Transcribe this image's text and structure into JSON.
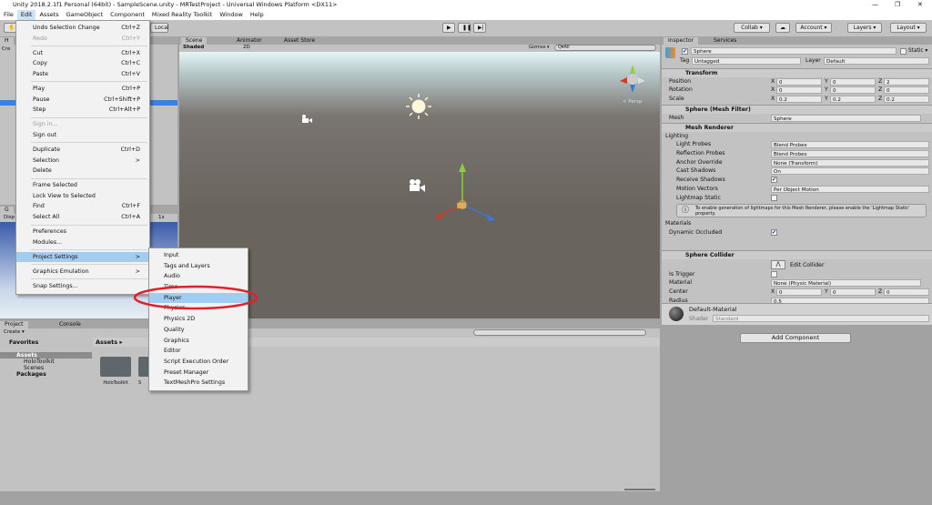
{
  "window": {
    "title": "Unity 2018.2.1f1 Personal (64bit) - SampleScene.unity - MRTestProject - Universal Windows Platform <DX11>"
  },
  "menubar": [
    "File",
    "Edit",
    "Assets",
    "GameObject",
    "Component",
    "Mixed Reality Toolkit",
    "Window",
    "Help"
  ],
  "toolbar": {
    "local": "Local",
    "collab": "Collab ▾",
    "account": "Account ▾",
    "layers": "Layers ▾",
    "layout": "Layout ▾"
  },
  "hierarchy": {
    "tab": "H",
    "create": "Cre"
  },
  "game": {
    "tab": "G",
    "display": "Disp",
    "scale": "1x"
  },
  "scene": {
    "tabs": [
      "Scene",
      "Animator",
      "Asset Store"
    ],
    "shading": "Shaded",
    "mode2d": "2D",
    "gizmos": "Gizmos ▾",
    "search_placeholder": "Q▾All",
    "persp": "< Persp"
  },
  "edit_menu": [
    {
      "label": "Undo Selection Change",
      "shortcut": "Ctrl+Z"
    },
    {
      "label": "Redo",
      "shortcut": "Ctrl+Y",
      "disabled": true
    },
    {
      "sep": true
    },
    {
      "label": "Cut",
      "shortcut": "Ctrl+X"
    },
    {
      "label": "Copy",
      "shortcut": "Ctrl+C"
    },
    {
      "label": "Paste",
      "shortcut": "Ctrl+V"
    },
    {
      "sep": true
    },
    {
      "label": "Play",
      "shortcut": "Ctrl+P"
    },
    {
      "label": "Pause",
      "shortcut": "Ctrl+Shift+P"
    },
    {
      "label": "Step",
      "shortcut": "Ctrl+Alt+P"
    },
    {
      "sep": true
    },
    {
      "label": "Sign in...",
      "disabled": true
    },
    {
      "label": "Sign out"
    },
    {
      "sep": true
    },
    {
      "label": "Duplicate",
      "shortcut": "Ctrl+D"
    },
    {
      "label": "Selection",
      "shortcut": ">"
    },
    {
      "label": "Delete"
    },
    {
      "sep": true
    },
    {
      "label": "Frame Selected"
    },
    {
      "label": "Lock View to Selected"
    },
    {
      "label": "Find",
      "shortcut": "Ctrl+F"
    },
    {
      "label": "Select All",
      "shortcut": "Ctrl+A"
    },
    {
      "sep": true
    },
    {
      "label": "Preferences"
    },
    {
      "label": "Modules..."
    },
    {
      "sep": true
    },
    {
      "label": "Project Settings",
      "shortcut": ">",
      "highlighted": true
    },
    {
      "sep": true
    },
    {
      "label": "Graphics Emulation",
      "shortcut": ">"
    },
    {
      "sep": true
    },
    {
      "label": "Snap Settings..."
    }
  ],
  "project_settings_menu": [
    "Input",
    "Tags and Layers",
    "Audio",
    "Time",
    "Player",
    "Physics",
    "Physics 2D",
    "Quality",
    "Graphics",
    "Editor",
    "Script Execution Order",
    "Preset Manager",
    "TextMeshPro Settings"
  ],
  "project_settings_selected": "Player",
  "highlight_color": "#e0202a",
  "inspector": {
    "tabs": [
      "Inspector",
      "Services"
    ],
    "name": "Sphere",
    "static": "Static ▾",
    "tag_label": "Tag",
    "tag": "Untagged",
    "layer_label": "Layer",
    "layer": "Default",
    "transform": {
      "title": "Transform",
      "rows": [
        {
          "label": "Position",
          "x": "0",
          "y": "0",
          "z": "2"
        },
        {
          "label": "Rotation",
          "x": "0",
          "y": "0",
          "z": "0"
        },
        {
          "label": "Scale",
          "x": "0.2",
          "y": "0.2",
          "z": "0.2"
        }
      ]
    },
    "mesh_filter": {
      "title": "Sphere (Mesh Filter)",
      "mesh_label": "Mesh",
      "mesh": "Sphere"
    },
    "mesh_renderer": {
      "title": "Mesh Renderer",
      "lighting": "Lighting",
      "rows": [
        {
          "label": "Light Probes",
          "value": "Blend Probes"
        },
        {
          "label": "Reflection Probes",
          "value": "Blend Probes"
        },
        {
          "label": "Anchor Override",
          "value": "None (Transform)"
        },
        {
          "label": "Cast Shadows",
          "value": "On"
        },
        {
          "label": "Receive Shadows",
          "value": "✔"
        },
        {
          "label": "Motion Vectors",
          "value": "Per Object Motion"
        },
        {
          "label": "Lightmap Static",
          "value": ""
        }
      ],
      "info": "To enable generation of lightmaps for this Mesh Renderer, please enable the 'Lightmap Static' property.",
      "materials": "Materials",
      "dynamic_occluded": "Dynamic Occluded"
    },
    "sphere_collider": {
      "title": "Sphere Collider",
      "edit": "Edit Collider",
      "is_trigger": "Is Trigger",
      "material_label": "Material",
      "material": "None (Physic Material)",
      "center_label": "Center",
      "cx": "0",
      "cy": "0",
      "cz": "0",
      "radius_label": "Radius",
      "radius": "0.5"
    },
    "material": {
      "name": "Default-Material",
      "shader_label": "Shader",
      "shader": "Standard"
    },
    "add_component": "Add Component"
  },
  "project": {
    "tabs": [
      "Project",
      "Console"
    ],
    "create": "Create ▾",
    "favorites": "Favorites",
    "assets": "Assets",
    "tree": [
      "HoloToolkit",
      "Scenes"
    ],
    "packages": "Packages",
    "breadcrumb": "Assets ▸",
    "folders": [
      "HoloToolkit",
      "S"
    ]
  }
}
